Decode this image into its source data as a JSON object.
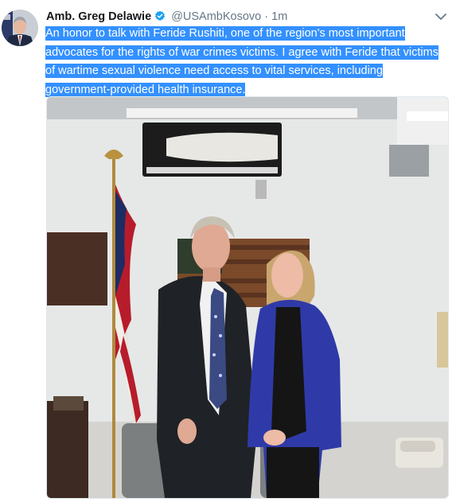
{
  "tweet": {
    "author_name": "Amb. Greg Delawie",
    "handle": "@USAmbKosovo",
    "separator": "·",
    "time": "1m",
    "text": "An honor to talk with Feride Rushiti, one of the region's most important advocates for the rights of war crimes victims. I agree with Feride that victims of wartime sexual violence need access to vital services, including government-provided health insurance."
  },
  "icons": {
    "verified": "verified-badge-icon",
    "more": "chevron-down-icon"
  },
  "colors": {
    "selection": "#3390ff",
    "verified": "#1da1f2",
    "secondary_text": "#657786"
  }
}
